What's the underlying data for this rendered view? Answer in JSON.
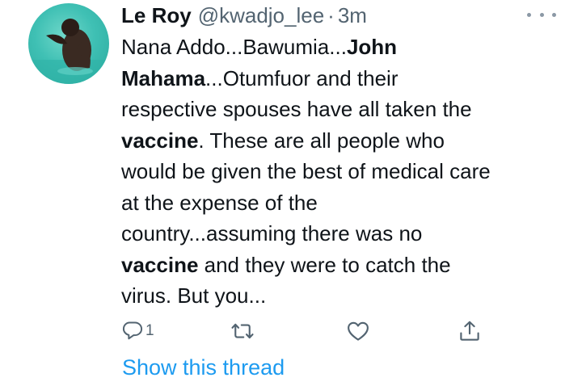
{
  "tweet": {
    "author_name": "Le Roy",
    "author_handle": "@kwadjo_lee",
    "separator": "·",
    "timestamp": "3m",
    "text_lines": [
      [
        {
          "t": "Nana Addo...Bawumia...",
          "b": false
        },
        {
          "t": "John",
          "b": true
        }
      ],
      [
        {
          "t": "Mahama",
          "b": true
        },
        {
          "t": "...Otumfuor and their",
          "b": false
        }
      ],
      [
        {
          "t": "respective spouses have all taken the",
          "b": false
        }
      ],
      [
        {
          "t": "vaccine",
          "b": true
        },
        {
          "t": ". These are all people who",
          "b": false
        }
      ],
      [
        {
          "t": "would be given the best of medical care",
          "b": false
        }
      ],
      [
        {
          "t": "at the expense of the",
          "b": false
        }
      ],
      [
        {
          "t": "country...assuming there was no",
          "b": false
        }
      ],
      [
        {
          "t": "vaccine",
          "b": true
        },
        {
          "t": " and they were to catch the",
          "b": false
        }
      ],
      [
        {
          "t": "virus. But you...",
          "b": false
        }
      ]
    ]
  },
  "actions": {
    "reply_count": "1",
    "reply_icon": "reply-icon",
    "retweet_icon": "retweet-icon",
    "like_icon": "heart-icon",
    "share_icon": "share-icon"
  },
  "thread_link": "Show this thread",
  "colors": {
    "link": "#1d9bf0",
    "secondary_text": "#536471",
    "primary_text": "#0f1419"
  }
}
